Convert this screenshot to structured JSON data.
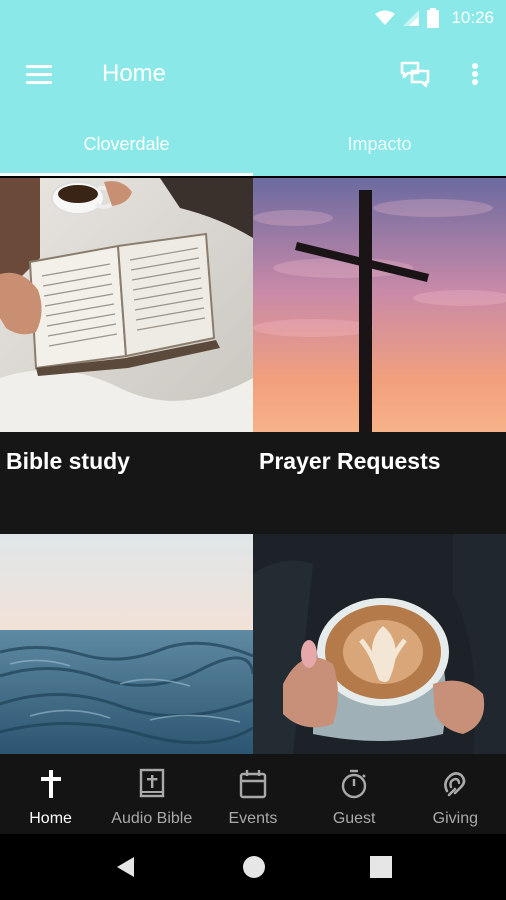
{
  "status": {
    "time": "10:26"
  },
  "appbar": {
    "title": "Home"
  },
  "tabs": [
    {
      "label": "Cloverdale",
      "active": true
    },
    {
      "label": "Impacto",
      "active": false
    }
  ],
  "cards": [
    {
      "title": "Bible study"
    },
    {
      "title": "Prayer Requests"
    },
    {
      "title": ""
    },
    {
      "title": ""
    }
  ],
  "bottom_nav": [
    {
      "label": "Home",
      "icon": "cross-icon",
      "active": true
    },
    {
      "label": "Audio Bible",
      "icon": "bible-icon",
      "active": false
    },
    {
      "label": "Events",
      "icon": "calendar-icon",
      "active": false
    },
    {
      "label": "Guest",
      "icon": "stopwatch-icon",
      "active": false
    },
    {
      "label": "Giving",
      "icon": "giving-icon",
      "active": false
    }
  ],
  "colors": {
    "accent": "#8ae8e9",
    "nav_bg": "#141414",
    "grid_bg": "#161616"
  }
}
